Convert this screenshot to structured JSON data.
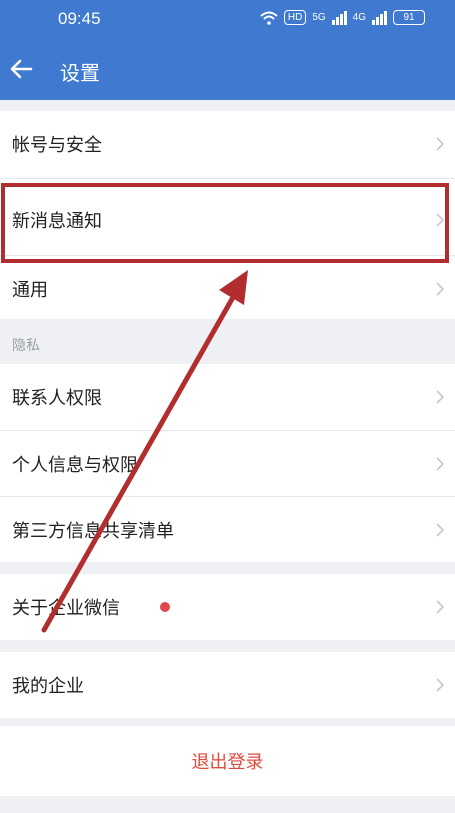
{
  "status": {
    "time": "09:45",
    "hd": "HD",
    "net1": "5G",
    "net2": "4G",
    "battery": "91"
  },
  "nav": {
    "title": "设置"
  },
  "menu": {
    "account_security": "帐号与安全",
    "new_message_notification": "新消息通知",
    "general": "通用",
    "privacy_label": "隐私",
    "contact_permissions": "联系人权限",
    "personal_info_permissions": "个人信息与权限",
    "third_party_sharing": "第三方信息共享清单",
    "about": "关于企业微信",
    "my_enterprise": "我的企业",
    "logout": "退出登录"
  },
  "colors": {
    "header": "#3f7ad0",
    "annotation": "#b22d2d",
    "logout": "#e04a3c",
    "badge": "#e0484a"
  }
}
